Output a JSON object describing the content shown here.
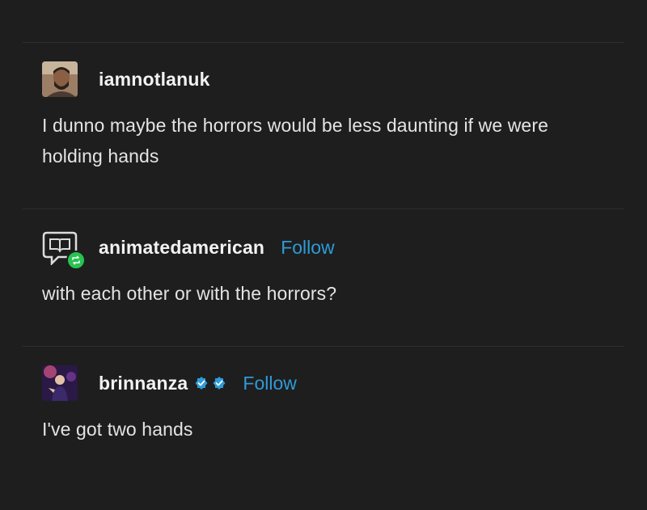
{
  "posts": [
    {
      "username": "iamnotlanuk",
      "avatar_icon": "person-photo-avatar",
      "text": "I dunno maybe the horrors would be less daunting if we were holding hands",
      "follow_label": null
    },
    {
      "username": "animatedamerican",
      "avatar_icon": "book-speech-bubble-avatar",
      "reblog_icon": "reblog-icon",
      "text": "with each other or with the horrors?",
      "follow_label": "Follow"
    },
    {
      "username": "brinnanza",
      "avatar_icon": "stage-photo-avatar",
      "badge_icons": [
        "verified-badge-icon",
        "verified-badge-icon"
      ],
      "text": "I've got two hands",
      "follow_label": "Follow"
    }
  ],
  "colors": {
    "background": "#1e1e1e",
    "text": "#e4e4e4",
    "follow": "#2e9bd8",
    "reblog": "#28c350",
    "verified": "#2e9bd8"
  }
}
